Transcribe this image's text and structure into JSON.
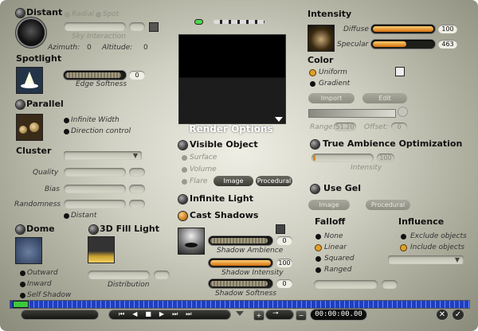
{
  "left": {
    "distant": {
      "title": "Distant",
      "radial": "Radial",
      "spot": "Spot",
      "sky_interaction": "Sky Interaction",
      "azimuth_label": "Azimuth:",
      "azimuth_value": "0",
      "altitude_label": "Altitude:",
      "altitude_value": "0"
    },
    "spotlight": {
      "title": "Spotlight",
      "edge_softness": "Edge Softness",
      "edge_softness_value": "0"
    },
    "parallel": {
      "title": "Parallel",
      "infinite_width": "Infinite Width",
      "direction_control": "Direction control"
    },
    "cluster": {
      "title": "Cluster",
      "quality": "Quality",
      "bias": "Bias",
      "randomness": "Randomness",
      "distant": "Distant"
    },
    "dome": {
      "title": "Dome",
      "outward": "Outward",
      "inward": "Inward",
      "self_shadow": "Self Shadow"
    },
    "fill_light": {
      "title": "3D Fill Light",
      "distribution": "Distribution"
    }
  },
  "center": {
    "title": "Render Options",
    "visible_object": "Visible Object",
    "surface": "Surface",
    "volume": "Volume",
    "flare": "Flare",
    "image_btn": "Image",
    "procedural_btn": "Procedural",
    "infinite_light": "Infinite Light",
    "cast_shadows": "Cast Shadows",
    "shadow_ambience": "Shadow Ambience",
    "shadow_ambience_value": "0",
    "shadow_intensity": "Shadow Intensity",
    "shadow_intensity_value": "100",
    "shadow_intensity_level": 1.0,
    "shadow_softness": "Shadow Softness",
    "shadow_softness_value": "0"
  },
  "right": {
    "intensity": "Intensity",
    "diffuse": "Diffuse",
    "diffuse_value": "100",
    "diffuse_level": 1.0,
    "specular": "Specular",
    "specular_value": "463",
    "specular_level": 0.55,
    "color": "Color",
    "uniform": "Uniform",
    "gradient": "Gradient",
    "import_btn": "Import",
    "edit_btn": "Edit",
    "range_label": "Range:",
    "range_value": "51.20",
    "offset_label": "Offset:",
    "offset_value": "0",
    "tao": "True Ambience Optimization",
    "tao_intensity": "Intensity",
    "tao_value": "100",
    "use_gel": "Use Gel",
    "gel_image": "Image",
    "gel_procedural": "Procedural",
    "falloff": "Falloff",
    "falloff_options": [
      "None",
      "Linear",
      "Squared",
      "Ranged"
    ],
    "influence": "Influence",
    "exclude": "Exclude objects",
    "include": "Include objects"
  },
  "bottom": {
    "timecode": "00:00:00.00",
    "plus": "+",
    "minus": "−"
  },
  "colors": {
    "accent_orange": "#e0a02a",
    "panel": "#cfcfc2",
    "dark_button": "#2a2a26",
    "timeline_blue": "#1f3fbf"
  }
}
